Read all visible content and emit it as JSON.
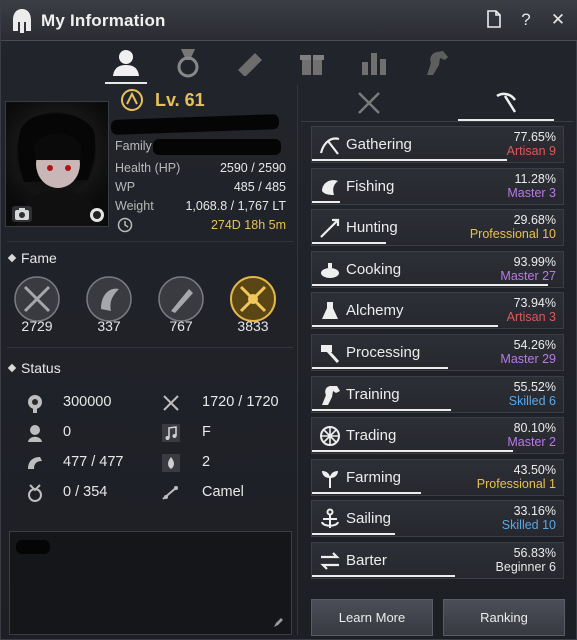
{
  "window": {
    "title": "My Information"
  },
  "top_tabs": [
    {
      "name": "character",
      "icon": "person-icon",
      "active": true
    },
    {
      "name": "medal",
      "icon": "medal-icon"
    },
    {
      "name": "knowledge",
      "icon": "scroll-icon"
    },
    {
      "name": "gift",
      "icon": "gift-icon"
    },
    {
      "name": "stats",
      "icon": "bar-chart-icon"
    },
    {
      "name": "horse",
      "icon": "horse-icon"
    }
  ],
  "character": {
    "level": "Lv. 61",
    "family_label": "Family",
    "stats": [
      {
        "label": "Health (HP)",
        "value": "2590 / 2590"
      },
      {
        "label": "WP",
        "value": "485 / 485"
      },
      {
        "label": "Weight",
        "value": "1,068.8 / 1,767 LT"
      }
    ],
    "playtime": "274D 18h 5m"
  },
  "fame": {
    "heading": "Fame",
    "items": [
      {
        "icon": "combat-fame-icon",
        "value": "2729"
      },
      {
        "icon": "life-fame-icon",
        "value": "337"
      },
      {
        "icon": "skill-fame-icon",
        "value": "767"
      },
      {
        "icon": "family-fame-icon",
        "value": "3833"
      }
    ]
  },
  "status": {
    "heading": "Status",
    "left": [
      {
        "icon": "contribution-icon",
        "value": "300000"
      },
      {
        "icon": "karma-icon",
        "value": "0"
      },
      {
        "icon": "energy-icon",
        "value": "477 / 477"
      },
      {
        "icon": "contribution-points-icon",
        "value": "0 / 354"
      }
    ],
    "right": [
      {
        "icon": "combat-icon",
        "value": "1720 / 1720"
      },
      {
        "icon": "music-icon",
        "value": "F"
      },
      {
        "icon": "stamina-icon",
        "value": "2"
      },
      {
        "icon": "mount-icon",
        "value": "Camel"
      }
    ]
  },
  "life_tabs": [
    {
      "icon": "crossed-swords-icon"
    },
    {
      "icon": "pickaxe-icon",
      "active": true
    }
  ],
  "skills": [
    {
      "name": "Gathering",
      "pct": "77.65%",
      "rank": "Artisan 9",
      "rank_color": "#e0585a",
      "fill": 0.7765,
      "icon": "gathering-icon"
    },
    {
      "name": "Fishing",
      "pct": "11.28%",
      "rank": "Master 3",
      "rank_color": "#b97ae8",
      "fill": 0.1128,
      "icon": "fishing-icon"
    },
    {
      "name": "Hunting",
      "pct": "29.68%",
      "rank": "Professional 10",
      "rank_color": "#e8c24e",
      "fill": 0.2968,
      "icon": "hunting-icon"
    },
    {
      "name": "Cooking",
      "pct": "93.99%",
      "rank": "Master 27",
      "rank_color": "#b97ae8",
      "fill": 0.9399,
      "icon": "cooking-icon"
    },
    {
      "name": "Alchemy",
      "pct": "73.94%",
      "rank": "Artisan 3",
      "rank_color": "#e0585a",
      "fill": 0.7394,
      "icon": "alchemy-icon"
    },
    {
      "name": "Processing",
      "pct": "54.26%",
      "rank": "Master 29",
      "rank_color": "#b97ae8",
      "fill": 0.5426,
      "icon": "processing-icon"
    },
    {
      "name": "Training",
      "pct": "55.52%",
      "rank": "Skilled 6",
      "rank_color": "#5aa8e6",
      "fill": 0.5552,
      "icon": "training-icon"
    },
    {
      "name": "Trading",
      "pct": "80.10%",
      "rank": "Master 2",
      "rank_color": "#b97ae8",
      "fill": 0.801,
      "icon": "trading-icon"
    },
    {
      "name": "Farming",
      "pct": "43.50%",
      "rank": "Professional 1",
      "rank_color": "#e8c24e",
      "fill": 0.435,
      "icon": "farming-icon"
    },
    {
      "name": "Sailing",
      "pct": "33.16%",
      "rank": "Skilled 10",
      "rank_color": "#5aa8e6",
      "fill": 0.3316,
      "icon": "sailing-icon"
    },
    {
      "name": "Barter",
      "pct": "56.83%",
      "rank": "Beginner 6",
      "rank_color": "#e8e8e8",
      "fill": 0.5683,
      "icon": "barter-icon"
    }
  ],
  "buttons": {
    "learn_more": "Learn More",
    "ranking": "Ranking"
  }
}
